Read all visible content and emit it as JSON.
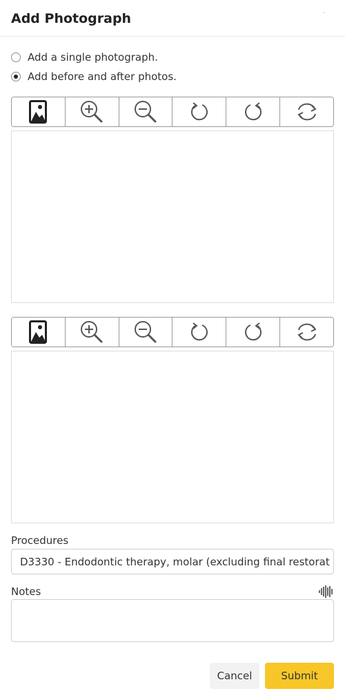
{
  "dialog": {
    "title": "Add Photograph"
  },
  "options": [
    {
      "label": "Add a single photograph.",
      "checked": false
    },
    {
      "label": "Add before and after photos.",
      "checked": true
    }
  ],
  "toolbar_icons": [
    "image-icon",
    "zoom-in-icon",
    "zoom-out-icon",
    "rotate-left-icon",
    "rotate-right-icon",
    "flip-icon"
  ],
  "procedures": {
    "label": "Procedures",
    "value": "D3330 - Endodontic therapy, molar (excluding final restorat"
  },
  "notes": {
    "label": "Notes",
    "value": ""
  },
  "actions": {
    "cancel": "Cancel",
    "submit": "Submit"
  },
  "colors": {
    "submit": "#f7c628",
    "cancel_bg": "#f2f2f2",
    "icon": "#555555"
  }
}
